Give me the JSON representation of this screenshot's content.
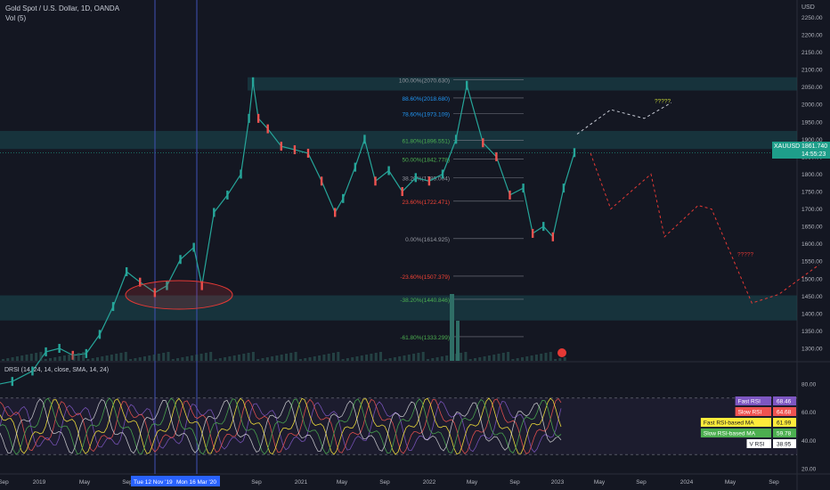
{
  "header": {
    "symbol_line": "Gold Spot / U.S. Dollar, 1D, OANDA",
    "vol_line": "Vol (5)",
    "currency": "USD"
  },
  "price_badge": {
    "symbol": "XAUUSD",
    "price": "1861.740",
    "countdown": "14:55:23",
    "color": "#1e9e8a"
  },
  "chart_data": [
    {
      "type": "line",
      "title": "Gold Spot / U.S. Dollar, 1D, OANDA",
      "ylabel": "USD",
      "ylim": [
        1255,
        2280
      ],
      "y_ticks": [
        2250.0,
        2200.0,
        2150.0,
        2100.0,
        2050.0,
        2000.0,
        1950.0,
        1900.0,
        1850.0,
        1800.0,
        1750.0,
        1700.0,
        1650.0,
        1600.0,
        1550.0,
        1500.0,
        1450.0,
        1400.0,
        1350.0,
        1300.0
      ],
      "x_ticks": [
        "Sep",
        "2019",
        "May",
        "Sep",
        "Tue 12 Nov '19",
        "Mon 16 Mar '20",
        "Sep",
        "2021",
        "May",
        "Sep",
        "2022",
        "May",
        "Sep",
        "2023",
        "May",
        "Sep",
        "2024",
        "May",
        "Sep"
      ],
      "highlighted_dates": [
        "Tue 12 Nov '19",
        "Mon 16 Mar '20"
      ],
      "series": [
        {
          "name": "XAUUSD",
          "x": [
            2018.67,
            2018.8,
            2018.95,
            2019.05,
            2019.15,
            2019.25,
            2019.35,
            2019.45,
            2019.55,
            2019.65,
            2019.75,
            2019.86,
            2019.95,
            2020.05,
            2020.15,
            2020.21,
            2020.3,
            2020.4,
            2020.5,
            2020.56,
            2020.59,
            2020.63,
            2020.7,
            2020.8,
            2020.9,
            2021.0,
            2021.1,
            2021.2,
            2021.26,
            2021.35,
            2021.42,
            2021.5,
            2021.6,
            2021.7,
            2021.8,
            2021.9,
            2022.0,
            2022.1,
            2022.18,
            2022.3,
            2022.4,
            2022.5,
            2022.6,
            2022.67,
            2022.75,
            2022.82,
            2022.9,
            2022.98
          ],
          "values": [
            1195,
            1205,
            1235,
            1290,
            1300,
            1280,
            1285,
            1340,
            1420,
            1520,
            1490,
            1460,
            1480,
            1555,
            1590,
            1480,
            1690,
            1740,
            1800,
            1960,
            2065,
            1960,
            1930,
            1880,
            1870,
            1860,
            1780,
            1690,
            1730,
            1820,
            1900,
            1780,
            1810,
            1750,
            1790,
            1780,
            1800,
            1900,
            2055,
            1890,
            1850,
            1740,
            1760,
            1630,
            1650,
            1620,
            1760,
            1861.74
          ]
        },
        {
          "name": "projection_up",
          "x": [
            2023.0,
            2023.25,
            2023.5,
            2023.7
          ],
          "values": [
            1915,
            1985,
            1960,
            2005
          ]
        },
        {
          "name": "projection_down",
          "x": [
            2023.1,
            2023.25,
            2023.55,
            2023.65,
            2023.9,
            2024.0,
            2024.3,
            2024.5,
            2024.8
          ],
          "values": [
            1860,
            1700,
            1800,
            1620,
            1710,
            1700,
            1430,
            1455,
            1540
          ]
        }
      ],
      "fibonacci": [
        {
          "label": "100.00%(2070.630)",
          "value": 2070.63
        },
        {
          "label": "88.60%(2018.680)",
          "value": 2018.68
        },
        {
          "label": "78.60%(1973.109)",
          "value": 1973.109
        },
        {
          "label": "61.80%(1896.551)",
          "value": 1896.551
        },
        {
          "label": "50.00%(1842.778)",
          "value": 1842.778
        },
        {
          "label": "38.20%(1789.004)",
          "value": 1789.004
        },
        {
          "label": "23.60%(1722.471)",
          "value": 1722.471
        },
        {
          "label": "0.00%(1614.925)",
          "value": 1614.925
        },
        {
          "label": "-23.60%(1507.379)",
          "value": 1507.379
        },
        {
          "label": "-38.20%(1440.846)",
          "value": 1440.846
        },
        {
          "label": "-61.80%(1333.299)",
          "value": 1333.299
        }
      ],
      "zones": [
        {
          "from": 2040,
          "to": 2078
        },
        {
          "from": 1872,
          "to": 1924
        },
        {
          "from": 1380,
          "to": 1452
        }
      ],
      "annotations": [
        "?????",
        "?????"
      ]
    },
    {
      "type": "line",
      "title": "DRSI (14, 24, 14, close, SMA, 14, 24)",
      "ylim": [
        15,
        95
      ],
      "y_ticks": [
        80.0,
        60.0,
        40.0,
        20.0
      ],
      "legend": [
        {
          "label": "Fast RSI",
          "value": "68.46",
          "color": "#7e57c2"
        },
        {
          "label": "Slow RSI",
          "value": "64.68",
          "color": "#ef5350"
        },
        {
          "label": "Fast RSI-based MA",
          "value": "61.99",
          "color": "#ffeb3b"
        },
        {
          "label": "Slow RSI-based MA",
          "value": "59.78",
          "color": "#4caf50"
        },
        {
          "label": "V RSI",
          "value": "38.95",
          "color": "#ffffff"
        }
      ]
    }
  ]
}
